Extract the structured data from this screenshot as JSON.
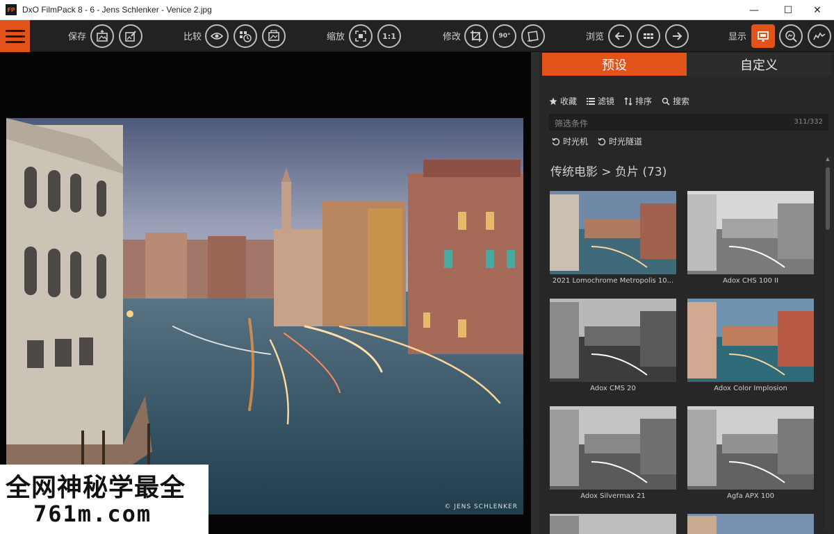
{
  "window": {
    "logo_text": "FP",
    "title": "DxO FilmPack 8 - 6 - Jens Schlenker - Venice 2.jpg",
    "minimize": "—",
    "maximize": "☐",
    "close": "✕"
  },
  "toolbar": {
    "save_label": "保存",
    "compare_label": "比较",
    "zoom_label": "缩放",
    "zoom_1to1": "1:1",
    "edit_label": "修改",
    "rotate_label": "90°",
    "browse_label": "浏览",
    "display_label": "显示"
  },
  "viewer": {
    "copyright": "© JENS SCHLENKER"
  },
  "watermark": {
    "line1": "全网神秘学最全",
    "line2": "761m.com"
  },
  "panel": {
    "tabs": [
      {
        "label": "预设",
        "active": true
      },
      {
        "label": "自定义",
        "active": false
      }
    ],
    "filter_row": [
      {
        "icon": "star-icon",
        "label": "收藏"
      },
      {
        "icon": "list-filter-icon",
        "label": "滤镜"
      },
      {
        "icon": "sort-icon",
        "label": "排序"
      },
      {
        "icon": "search-icon",
        "label": "搜索"
      }
    ],
    "criteria": {
      "label": "筛选条件",
      "count": "311/332"
    },
    "time_row": [
      {
        "icon": "time-machine-icon",
        "label": "时光机"
      },
      {
        "icon": "time-tunnel-icon",
        "label": "时光隧道"
      }
    ],
    "category_title": "传统电影 > 负片 (73)",
    "presets": [
      {
        "label": "2021 Lomochrome Metropolis 10..."
      },
      {
        "label": "Adox CHS 100 II"
      },
      {
        "label": "Adox CMS 20"
      },
      {
        "label": "Adox Color Implosion"
      },
      {
        "label": "Adox Silvermax 21"
      },
      {
        "label": "Agfa APX 100"
      }
    ]
  },
  "colors": {
    "accent": "#e2531a",
    "panel_bg": "#272727",
    "toolbar_bg": "#222222"
  }
}
